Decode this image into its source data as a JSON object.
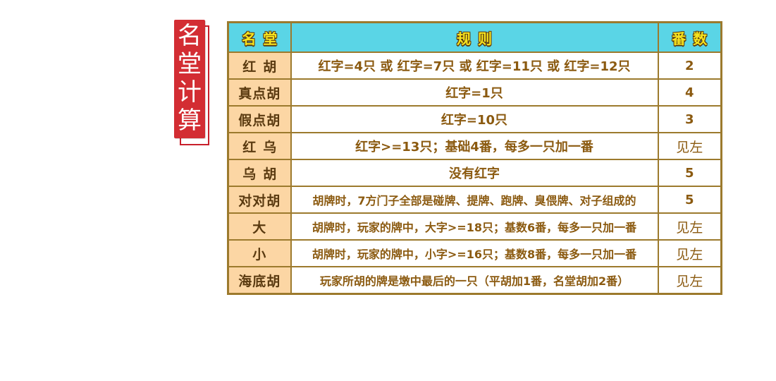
{
  "side_title": {
    "chars": [
      "名",
      "堂",
      "计",
      "算"
    ]
  },
  "table": {
    "headers": {
      "name": "名堂",
      "rule": "规则",
      "fan": "番数"
    },
    "rows": [
      {
        "name": "红胡",
        "rule": "红字=4只  或  红字=7只  或  红字=11只  或  红字=12只",
        "fan": "2"
      },
      {
        "name": "真点胡",
        "rule": "红字=1只",
        "fan": "4"
      },
      {
        "name": "假点胡",
        "rule": "红字=10只",
        "fan": "3"
      },
      {
        "name": "红乌",
        "rule": "红字>=13只；基础4番，每多一只加一番",
        "fan": "见左"
      },
      {
        "name": "乌胡",
        "rule": "没有红字",
        "fan": "5"
      },
      {
        "name": "对对胡",
        "rule": "胡牌时，7方门子全部是碰牌、提牌、跑牌、臭偎牌、对子组成的",
        "fan": "5"
      },
      {
        "name": "大",
        "rule": "胡牌时，玩家的牌中，大字>=18只；基数6番，每多一只加一番",
        "fan": "见左"
      },
      {
        "name": "小",
        "rule": "胡牌时，玩家的牌中，小字>=16只；基数8番，每多一只加一番",
        "fan": "见左"
      },
      {
        "name": "海底胡",
        "rule": "玩家所胡的牌是墩中最后的一只（平胡加1番，名堂胡加2番）",
        "fan": "见左"
      }
    ]
  },
  "colors": {
    "title_badge": "#d32d33",
    "header_bg": "#5ad5e6",
    "header_text": "#f7e41e",
    "name_cell_bg": "#fcd6a4",
    "border": "#9c7a2d",
    "text": "#8b5a10"
  }
}
